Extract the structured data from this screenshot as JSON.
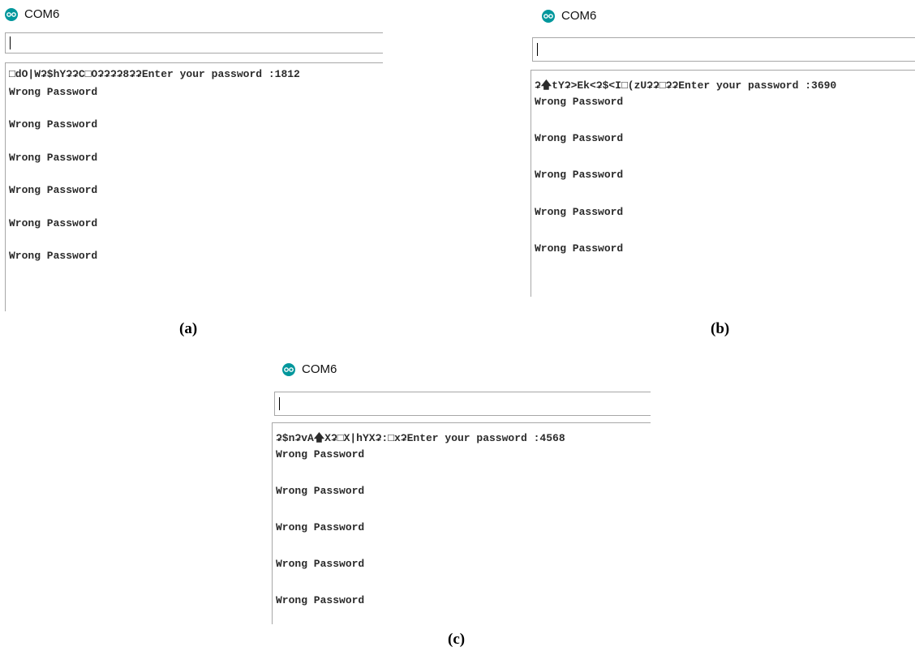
{
  "panels": [
    {
      "title": "COM6",
      "first_line": "□dO|Wʡ$hYʡʡC□Oʡʡʡʡ8ʡʡEnter your password :1812",
      "lines": [
        "Wrong Password",
        "Wrong Password",
        "Wrong Password",
        "Wrong Password",
        "Wrong Password",
        "Wrong Password"
      ],
      "caption": "(a)"
    },
    {
      "title": "COM6",
      "first_line": "ʡ🡅tYʡ>Ek<ʡ$<I□(zUʡʡ□ʡʡEnter your password :3690",
      "lines": [
        "Wrong Password",
        "Wrong Password",
        "Wrong Password",
        "Wrong Password",
        "Wrong Password"
      ],
      "caption": "(b)"
    },
    {
      "title": "COM6",
      "first_line": "ʡ$nʡvA🡅Xʡ□X|hYXʡ:□xʡEnter your password :4568",
      "lines": [
        "Wrong Password",
        "Wrong Password",
        "Wrong Password",
        "Wrong Password",
        "Wrong Password"
      ],
      "caption": "(c)"
    }
  ],
  "colors": {
    "arduino_logo": "#00979c",
    "border": "#a7a7a7"
  },
  "icons": {
    "logo": "arduino-logo-icon"
  }
}
